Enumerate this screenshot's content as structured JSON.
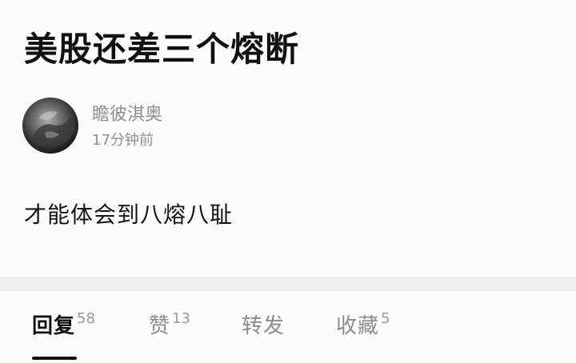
{
  "post": {
    "title": "美股还差三个熔断",
    "author": {
      "name": "瞻彼淇奥",
      "time": "17分钟前"
    },
    "body": "才能体会到八熔八耻"
  },
  "tabs": [
    {
      "label": "回复",
      "count": "58",
      "active": true
    },
    {
      "label": "赞",
      "count": "13",
      "active": false
    },
    {
      "label": "转发",
      "count": "",
      "active": false
    },
    {
      "label": "收藏",
      "count": "5",
      "active": false
    }
  ]
}
